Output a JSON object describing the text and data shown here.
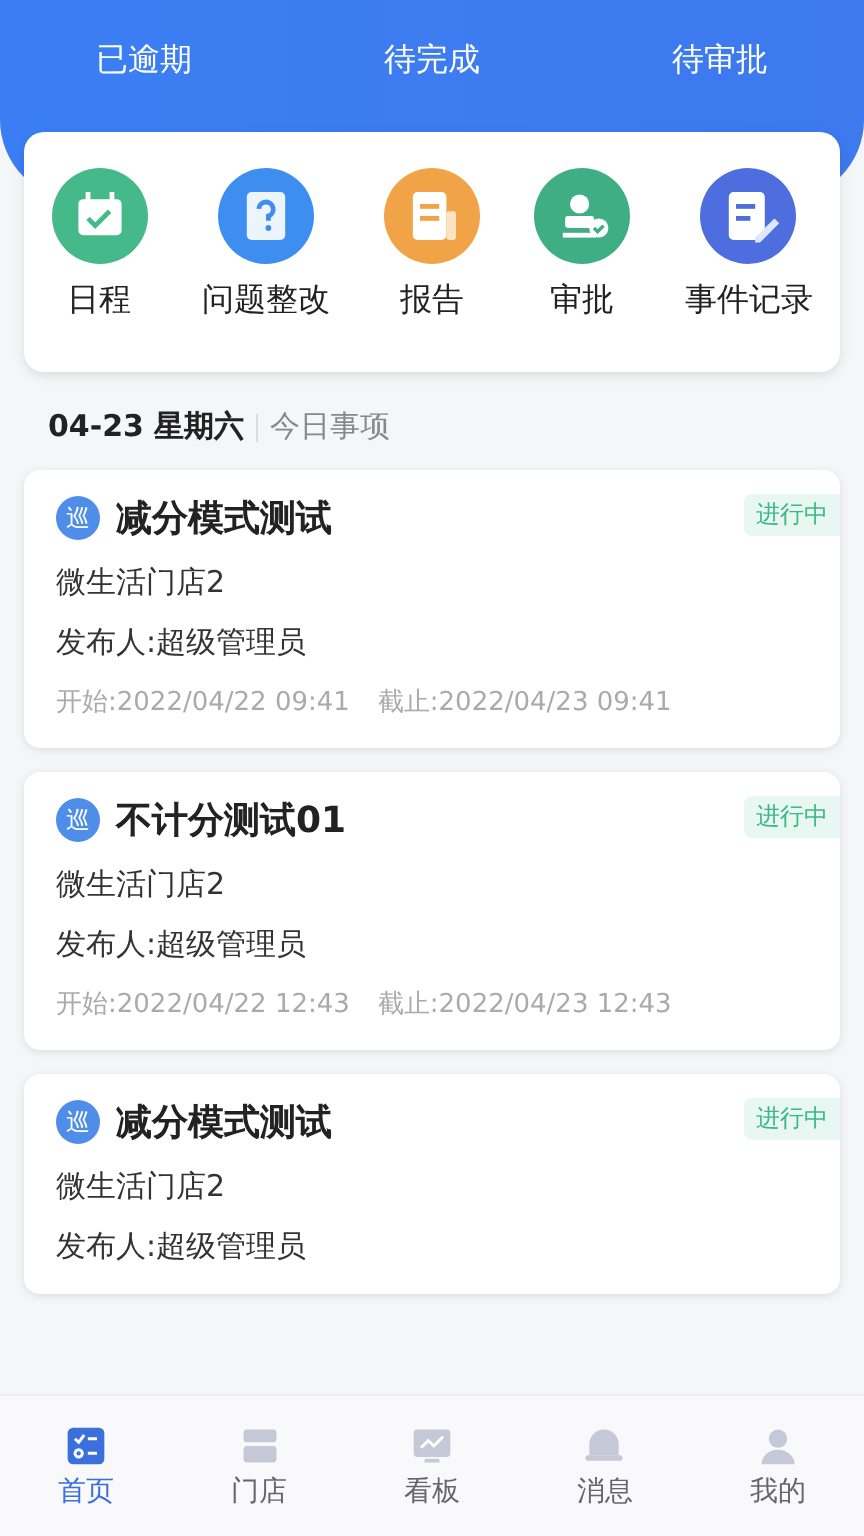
{
  "stats": [
    {
      "label": "已逾期"
    },
    {
      "label": "待完成"
    },
    {
      "label": "待审批"
    }
  ],
  "shortcuts": [
    {
      "label": "日程",
      "kind": "calendar"
    },
    {
      "label": "问题整改",
      "kind": "question"
    },
    {
      "label": "报告",
      "kind": "report"
    },
    {
      "label": "审批",
      "kind": "stamp"
    },
    {
      "label": "事件记录",
      "kind": "note"
    }
  ],
  "date": "04-23 星期六",
  "section": "今日事项",
  "tasks": [
    {
      "badge": "巡",
      "title": "减分模式测试",
      "status": "进行中",
      "store": "微生活门店2",
      "publisher": "发布人:超级管理员",
      "start": "开始:2022/04/22 09:41",
      "end": "截止:2022/04/23 09:41"
    },
    {
      "badge": "巡",
      "title": "不计分测试01",
      "status": "进行中",
      "store": "微生活门店2",
      "publisher": "发布人:超级管理员",
      "start": "开始:2022/04/22 12:43",
      "end": "截止:2022/04/23 12:43"
    },
    {
      "badge": "巡",
      "title": "减分模式测试",
      "status": "进行中",
      "store": "微生活门店2",
      "publisher": "发布人:超级管理员"
    }
  ],
  "tabs": [
    {
      "label": "首页",
      "kind": "home",
      "selected": true
    },
    {
      "label": "门店",
      "kind": "store",
      "selected": false
    },
    {
      "label": "看板",
      "kind": "board",
      "selected": false
    },
    {
      "label": "消息",
      "kind": "message",
      "selected": false
    },
    {
      "label": "我的",
      "kind": "profile",
      "selected": false
    }
  ]
}
